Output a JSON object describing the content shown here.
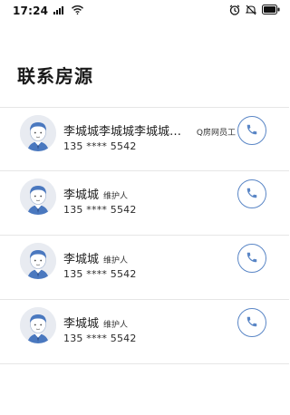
{
  "status_bar": {
    "time": "17:24",
    "icons": [
      "signal-icon",
      "wifi-icon",
      "alarm-icon",
      "mute-icon",
      "battery-icon"
    ]
  },
  "page_title": "联系房源",
  "contacts": [
    {
      "name": "李城城李城城李城城城城...",
      "role": "Q房网员工",
      "phone": "135 **** 5542",
      "avatar_icon": "agent-avatar-icon",
      "call_icon": "phone-icon"
    },
    {
      "name": "李城城",
      "role": "维护人",
      "phone": "135 **** 5542",
      "avatar_icon": "agent-avatar-icon",
      "call_icon": "phone-icon"
    },
    {
      "name": "李城城",
      "role": "维护人",
      "phone": "135 **** 5542",
      "avatar_icon": "agent-avatar-icon",
      "call_icon": "phone-icon"
    },
    {
      "name": "李城城",
      "role": "维护人",
      "phone": "135 **** 5542",
      "avatar_icon": "agent-avatar-icon",
      "call_icon": "phone-icon"
    }
  ],
  "colors": {
    "accent": "#5a86c6",
    "divider": "#e6e6e6",
    "avatar_bg": "#e8ebf1"
  }
}
